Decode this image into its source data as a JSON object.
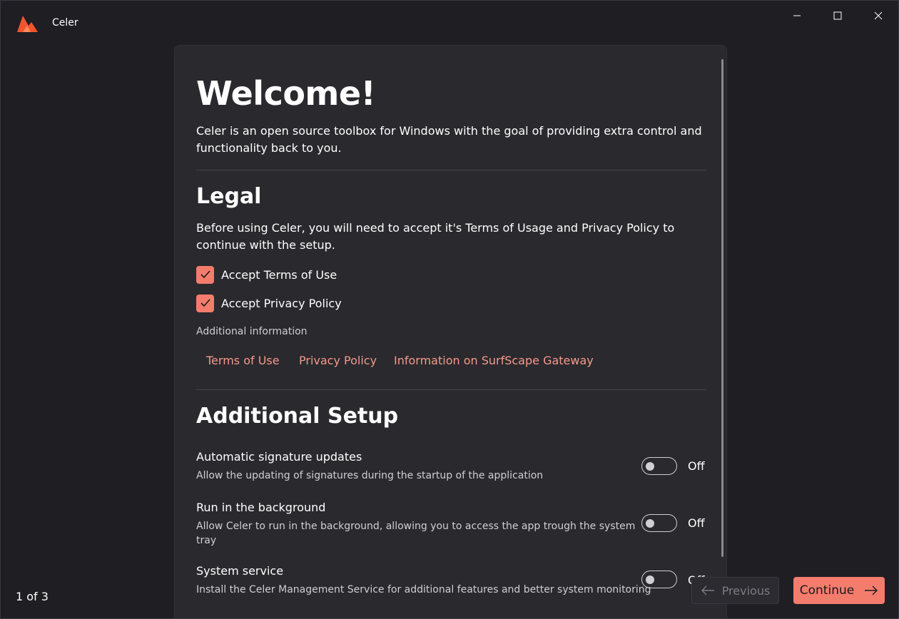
{
  "window": {
    "title": "Celer"
  },
  "welcome": {
    "heading": "Welcome!",
    "intro": "Celer is an open source toolbox for Windows with the goal of providing extra control and functionality back to you."
  },
  "legal": {
    "heading": "Legal",
    "description": "Before using Celer, you will need to accept it's Terms of Usage and Privacy Policy to continue with the setup.",
    "checkboxes": [
      {
        "label": "Accept Terms of Use",
        "checked": true
      },
      {
        "label": "Accept Privacy Policy",
        "checked": true
      }
    ],
    "additional_info_label": "Additional information",
    "links": [
      "Terms of Use",
      "Privacy Policy",
      "Information on SurfScape Gateway"
    ]
  },
  "setup": {
    "heading": "Additional Setup",
    "settings": [
      {
        "title": "Automatic signature updates",
        "description": "Allow the updating of signatures during the startup of the application",
        "state": "Off"
      },
      {
        "title": "Run in the background",
        "description": "Allow Celer to run in the background, allowing you to access the app trough the system tray",
        "state": "Off"
      },
      {
        "title": "System service",
        "description": "Install the Celer Management Service for additional features and better system monitoring",
        "state": "Off"
      }
    ]
  },
  "footer": {
    "page_indicator": "1 of 3",
    "previous_label": "Previous",
    "continue_label": "Continue"
  },
  "colors": {
    "accent": "#f47c6c",
    "link": "#f59a8c",
    "background": "#1f1e23",
    "card": "#2a292e"
  }
}
